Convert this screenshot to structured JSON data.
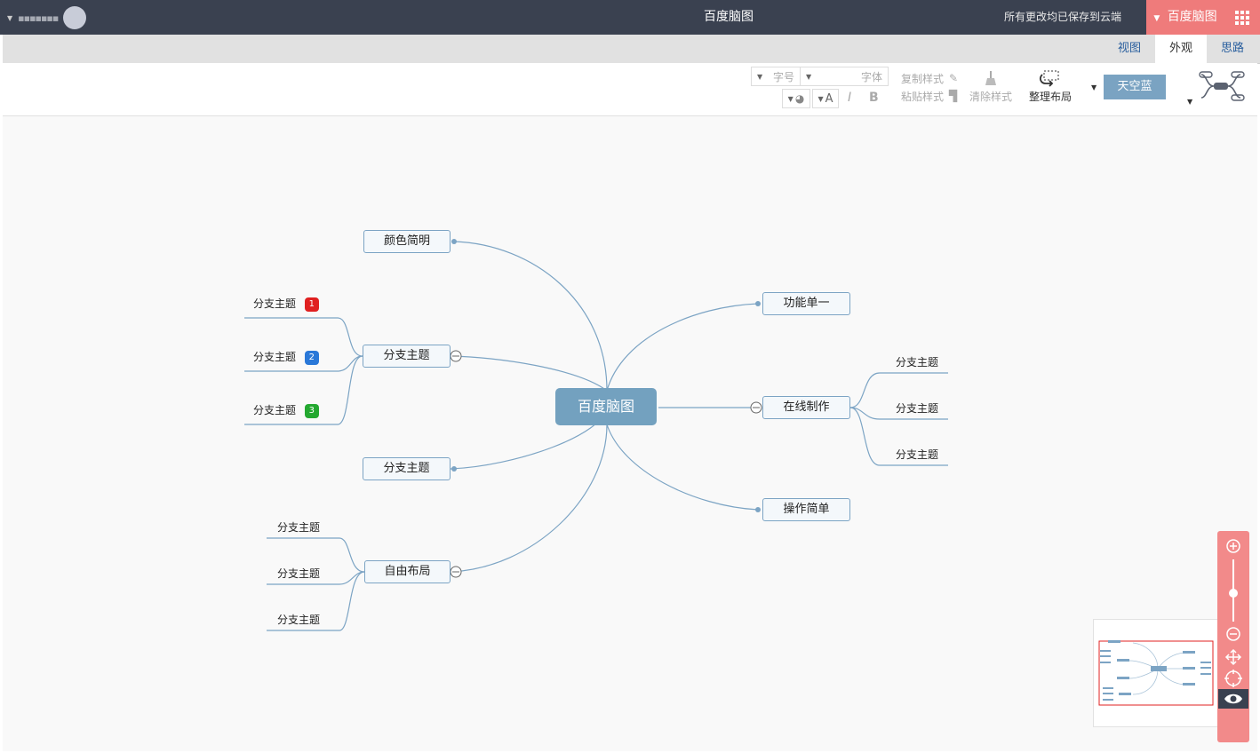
{
  "topbar": {
    "brand": "百度脑图",
    "save_status": "所有更改均已保存到云端",
    "doc_title": "百度脑图",
    "user_name": "▪▪▪▪▪▪▪"
  },
  "tabs": [
    {
      "label": "思路",
      "active": false
    },
    {
      "label": "外观",
      "active": true
    },
    {
      "label": "视图",
      "active": false
    }
  ],
  "ribbon": {
    "theme_label": "天空蓝",
    "arrange_label": "整理布局",
    "clear_style": "清除样式",
    "copy_style": "复制样式",
    "paste_style": "粘贴样式",
    "font_placeholder": "字体",
    "size_placeholder": "字号",
    "bold": "B",
    "italic": "I",
    "font_color": "A"
  },
  "mindmap": {
    "root": "百度脑图",
    "left": [
      {
        "label": "颜色简明",
        "children": []
      },
      {
        "label": "分支主题",
        "children": [
          {
            "label": "分支主题",
            "badge": "1",
            "badge_color": "#e02020"
          },
          {
            "label": "分支主题",
            "badge": "2",
            "badge_color": "#2a78d8"
          },
          {
            "label": "分支主题",
            "badge": "3",
            "badge_color": "#24a830"
          }
        ]
      },
      {
        "label": "分支主题",
        "children": []
      },
      {
        "label": "自由布局",
        "children": [
          {
            "label": "分支主题"
          },
          {
            "label": "分支主题"
          },
          {
            "label": "分支主题"
          }
        ]
      }
    ],
    "right": [
      {
        "label": "功能单一",
        "children": []
      },
      {
        "label": "在线制作",
        "children": [
          {
            "label": "分支主题"
          },
          {
            "label": "分支主题"
          },
          {
            "label": "分支主题"
          }
        ]
      },
      {
        "label": "操作简单",
        "children": []
      }
    ]
  },
  "colors": {
    "topbar": "#3a4150",
    "accent": "#ef7b7b",
    "line": "#7ca4c4",
    "root": "#73a1bf"
  }
}
